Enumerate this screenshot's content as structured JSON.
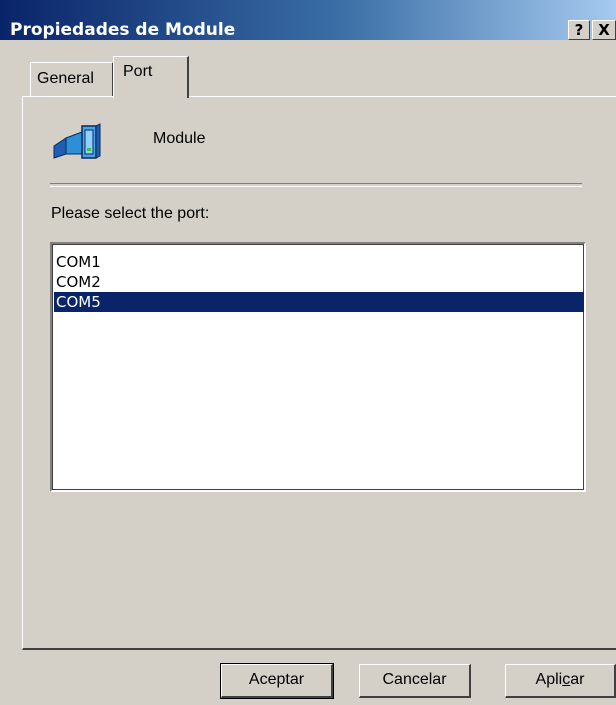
{
  "window": {
    "title": "Propiedades de Module",
    "help_label": "?",
    "close_label": "X"
  },
  "tabs": [
    {
      "label": "General",
      "selected": false
    },
    {
      "label": "Port",
      "selected": true
    }
  ],
  "device": {
    "icon": "module-device-icon",
    "name": "Module"
  },
  "port_selector": {
    "prompt": "Please select the port:",
    "options": [
      "COM1",
      "COM2",
      "COM5"
    ],
    "selected": "COM5"
  },
  "buttons": {
    "ok": "Aceptar",
    "cancel": "Cancelar",
    "apply_pre": "Apli",
    "apply_accel": "c",
    "apply_post": "ar"
  },
  "colors": {
    "selection": "#0a246a",
    "face": "#d4d0c8"
  }
}
